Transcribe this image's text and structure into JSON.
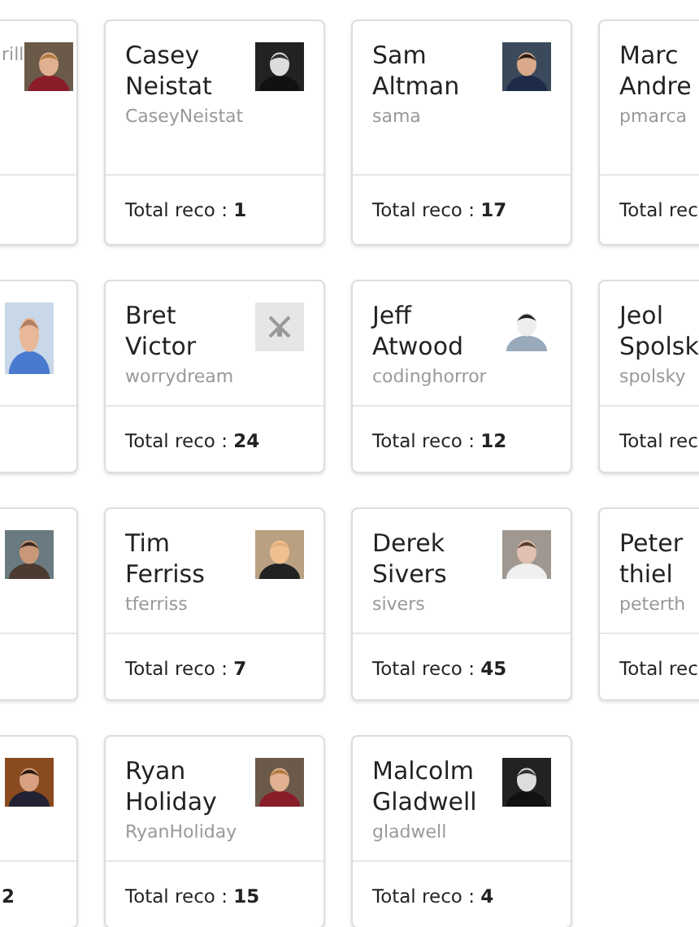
{
  "cards": [
    {
      "kind": "partial-left",
      "username": "rill"
    },
    {
      "kind": "full",
      "name": "Casey Neistat",
      "username": "CaseyNeistat",
      "total": "Total reco : **1**"
    },
    {
      "kind": "full",
      "name": "Sam Altman",
      "username": "sama",
      "total": "Total reco : **17**"
    },
    {
      "kind": "partial-right",
      "name": "Marc Andre",
      "username": "pmarca",
      "total": "Total rec"
    },
    {
      "kind": "partial-left"
    },
    {
      "kind": "full",
      "name": "Bret Victor",
      "username": "worrydream",
      "total": "Total reco : **24**"
    },
    {
      "kind": "full",
      "name": "Jeff Atwood",
      "username": "codinghorror",
      "total": "Total reco : **12**"
    },
    {
      "kind": "partial-right",
      "name": "Jeol Spolsk",
      "username": "spolsky",
      "total": "Total rec"
    },
    {
      "kind": "partial-left"
    },
    {
      "kind": "full",
      "name": "Tim Ferriss",
      "username": "tferriss",
      "total": "Total reco : **7**"
    },
    {
      "kind": "full",
      "name": "Derek Sivers",
      "username": "sivers",
      "total": "Total reco : **45**"
    },
    {
      "kind": "partial-right",
      "name": "Peter thiel",
      "username": "peterth",
      "total": "Total rec"
    },
    {
      "kind": "partial-left",
      "total": "2"
    },
    {
      "kind": "full",
      "name": "Ryan Holiday",
      "username": "RyanHoliday",
      "total": "Total reco : **15**"
    },
    {
      "kind": "full",
      "name": "Malcolm Gladwell",
      "username": "gladwell",
      "total": "Total reco : **4**"
    }
  ]
}
